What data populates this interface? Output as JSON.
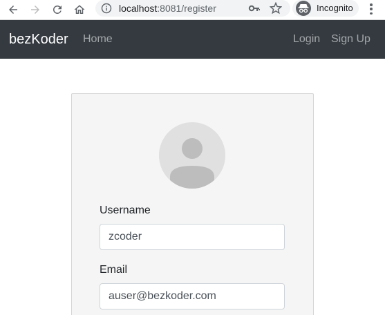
{
  "browser": {
    "url_host": "localhost",
    "url_rest": ":8081/register",
    "incognito_label": "Incognito",
    "icons": [
      "back-arrow-icon",
      "forward-arrow-icon",
      "reload-icon",
      "home-icon",
      "info-icon",
      "key-icon",
      "star-icon",
      "incognito-icon",
      "more-vert-icon"
    ]
  },
  "navbar": {
    "brand": "bezKoder",
    "home": "Home",
    "login": "Login",
    "signup": "Sign Up",
    "bg_color": "#343a40"
  },
  "form": {
    "avatar_icon": "user-avatar-icon",
    "username_label": "Username",
    "username_value": "zcoder",
    "email_label": "Email",
    "email_value": "auser@bezkoder.com"
  }
}
